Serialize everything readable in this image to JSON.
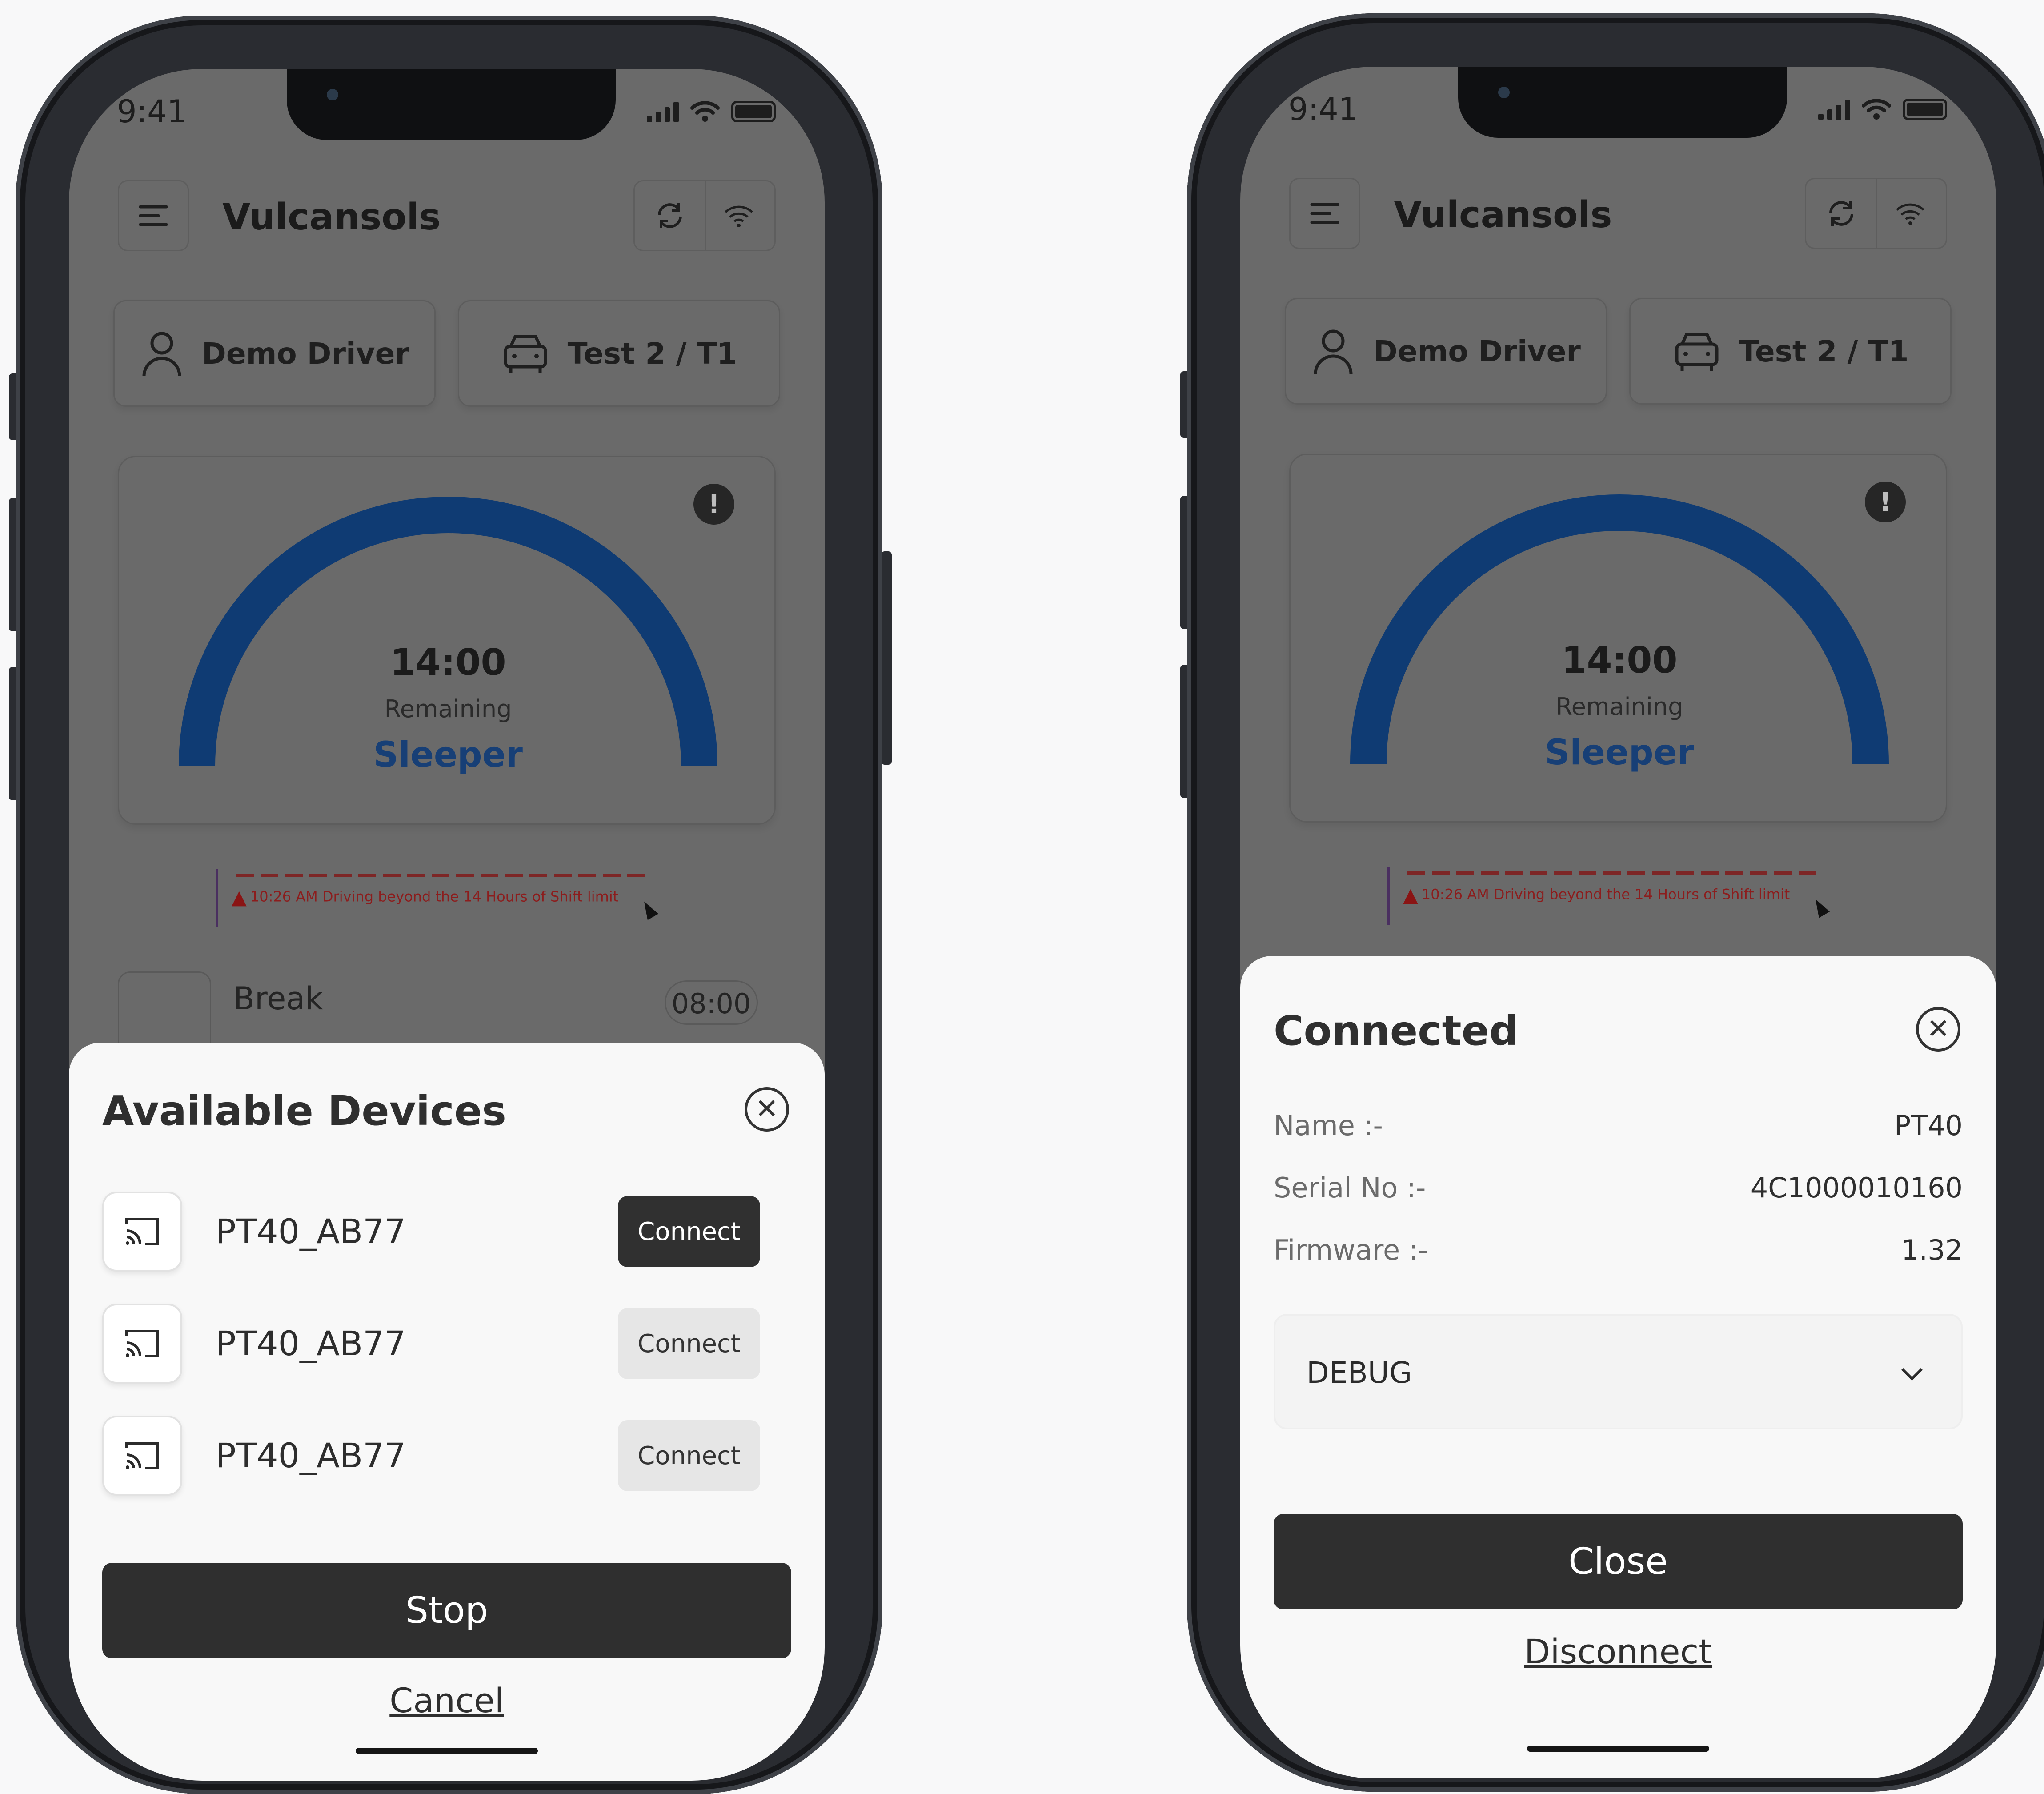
{
  "status_time": "9:41",
  "app": {
    "name": "Vulcansols"
  },
  "driver": {
    "name": "Demo Driver"
  },
  "vehicle": {
    "name": "Test 2 / T1"
  },
  "gauge": {
    "time": "14:00",
    "label": "Remaining",
    "status": "Sleeper",
    "arc_color": "#0f3b73"
  },
  "alert": {
    "text": "10:26 AM Driving beyond the 14 Hours of Shift limit"
  },
  "peek": {
    "label": "Break",
    "value": "08:00"
  },
  "devices_sheet": {
    "title": "Available Devices",
    "devices": [
      {
        "name": "PT40_AB77",
        "button": "Connect"
      },
      {
        "name": "PT40_AB77",
        "button": "Connect"
      },
      {
        "name": "PT40_AB77",
        "button": "Connect"
      }
    ],
    "stop_label": "Stop",
    "cancel_label": "Cancel"
  },
  "connected_sheet": {
    "title": "Connected",
    "fields": [
      {
        "label": "Name :-",
        "value": "PT40"
      },
      {
        "label": "Serial No :-",
        "value": "4C1000010160"
      },
      {
        "label": "Firmware :-",
        "value": "1.32"
      }
    ],
    "log_level": "DEBUG",
    "close_label": "Close",
    "disconnect_label": "Disconnect"
  },
  "icons": [
    "menu-icon",
    "refresh-icon",
    "wifi-icon",
    "user-icon",
    "car-icon",
    "info-icon",
    "cast-icon",
    "close-circle-icon",
    "chevron-down-icon",
    "warning-icon"
  ]
}
